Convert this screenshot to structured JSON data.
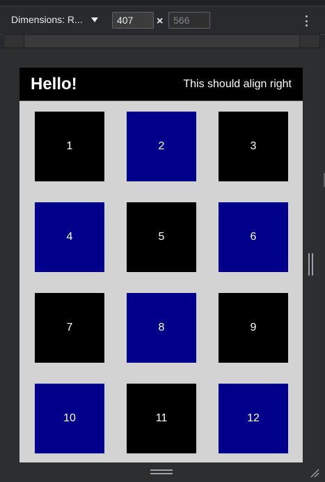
{
  "devtools": {
    "dimensions_label": "Dimensions: R...",
    "width_value": "407",
    "height_placeholder": "566",
    "times_symbol": "×"
  },
  "page": {
    "title": "Hello!",
    "aside": "This should align right"
  },
  "tiles": [
    {
      "label": "1",
      "color": "#000000"
    },
    {
      "label": "2",
      "color": "#00008b"
    },
    {
      "label": "3",
      "color": "#000000"
    },
    {
      "label": "4",
      "color": "#00008b"
    },
    {
      "label": "5",
      "color": "#000000"
    },
    {
      "label": "6",
      "color": "#00008b"
    },
    {
      "label": "7",
      "color": "#000000"
    },
    {
      "label": "8",
      "color": "#00008b"
    },
    {
      "label": "9",
      "color": "#000000"
    },
    {
      "label": "10",
      "color": "#00008b"
    },
    {
      "label": "11",
      "color": "#000000"
    },
    {
      "label": "12",
      "color": "#00008b"
    }
  ],
  "colors": {
    "devtools_bg": "#292a2d",
    "viewport_bg": "#d3d3d3",
    "header_bg": "#000000",
    "tile_dark": "#000000",
    "tile_blue": "#00008b"
  }
}
